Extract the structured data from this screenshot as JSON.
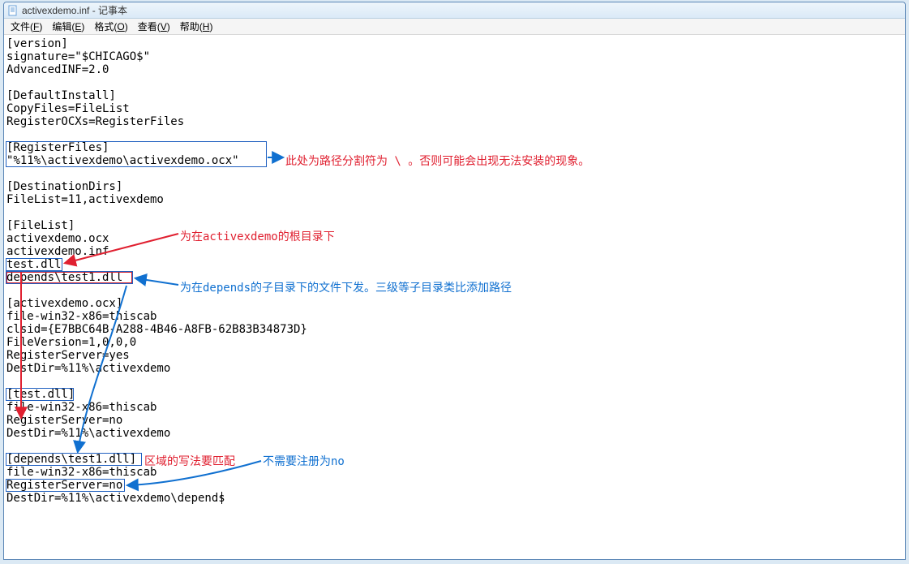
{
  "title": "activexdemo.inf - 记事本",
  "menu": {
    "file": {
      "label": "文件",
      "key": "F"
    },
    "edit": {
      "label": "编辑",
      "key": "E"
    },
    "format": {
      "label": "格式",
      "key": "O"
    },
    "view": {
      "label": "查看",
      "key": "V"
    },
    "help": {
      "label": "帮助",
      "key": "H"
    }
  },
  "lines": [
    "[version]",
    "signature=\"$CHICAGO$\"",
    "AdvancedINF=2.0",
    "",
    "[DefaultInstall]",
    "CopyFiles=FileList",
    "RegisterOCXs=RegisterFiles",
    "",
    "[RegisterFiles]",
    "\"%11%\\activexdemo\\activexdemo.ocx\"",
    "",
    "[DestinationDirs]",
    "FileList=11,activexdemo",
    "",
    "[FileList]",
    "activexdemo.ocx",
    "activexdemo.inf",
    "test.dll",
    "depends\\test1.dll",
    "",
    "[activexdemo.ocx]",
    "file-win32-x86=thiscab",
    "clsid={E7BBC64B-A288-4B46-A8FB-62B83B34873D}",
    "FileVersion=1,0,0,0",
    "RegisterServer=yes",
    "DestDir=%11%\\activexdemo",
    "",
    "[test.dll]",
    "file-win32-x86=thiscab",
    "RegisterServer=no",
    "DestDir=%11%\\activexdemo",
    "",
    "[depends\\test1.dll]",
    "file-win32-x86=thiscab",
    "RegisterServer=no",
    "DestDir=%11%\\activexdemo\\depends"
  ],
  "annotations": {
    "a1": "此处为路径分割符为 \\ 。否则可能会出现无法安装的现象。",
    "a2": "为在activexdemo的根目录下",
    "a3": "为在depends的子目录下的文件下发。三级等子目录类比添加路径",
    "a4": "区域的写法要匹配",
    "a5": "不需要注册为no"
  }
}
